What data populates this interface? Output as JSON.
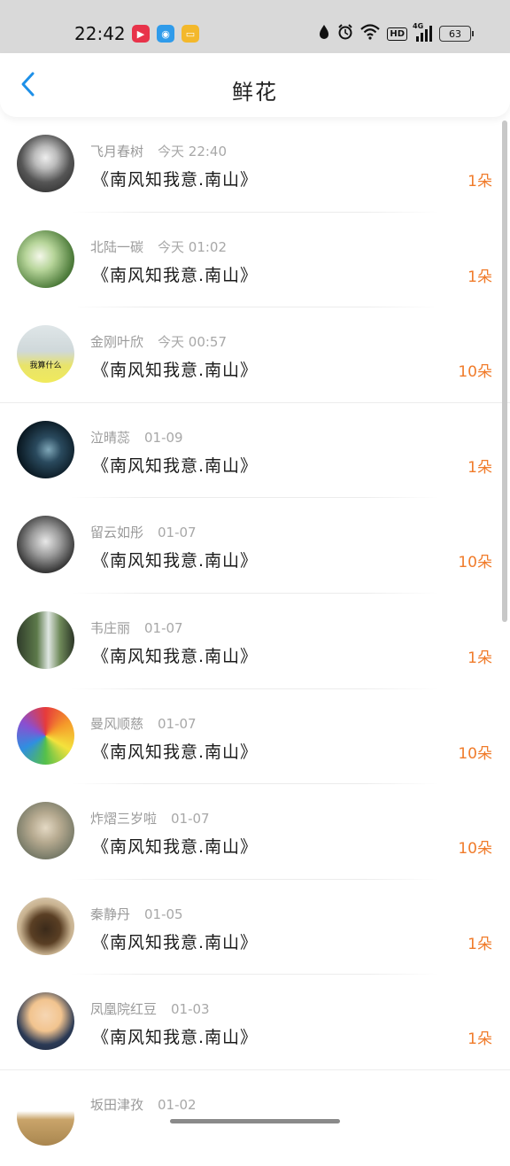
{
  "status_bar": {
    "time": "22:42",
    "battery": "63",
    "network_label": "HD",
    "signal_label": "4G"
  },
  "header": {
    "title": "鲜花",
    "back_icon": "chevron-left-icon"
  },
  "colors": {
    "accent": "#1e90e8",
    "count": "#f07b2a",
    "meta": "#9a9a9a"
  },
  "items": [
    {
      "name": "飞月春树",
      "time": "今天 22:40",
      "message": "《南风知我意.南山》",
      "count": "1朵"
    },
    {
      "name": "北陆一碳",
      "time": "今天 01:02",
      "message": "《南风知我意.南山》",
      "count": "1朵"
    },
    {
      "name": "金刚叶欣",
      "time": "今天 00:57",
      "message": "《南风知我意.南山》",
      "count": "10朵",
      "avatar_caption": "我算什么"
    },
    {
      "name": "泣晴蕊",
      "time": "01-09",
      "message": "《南风知我意.南山》",
      "count": "1朵"
    },
    {
      "name": "留云如彤",
      "time": "01-07",
      "message": "《南风知我意.南山》",
      "count": "10朵"
    },
    {
      "name": "韦庄丽",
      "time": "01-07",
      "message": "《南风知我意.南山》",
      "count": "1朵"
    },
    {
      "name": "曼风顺慈",
      "time": "01-07",
      "message": "《南风知我意.南山》",
      "count": "10朵"
    },
    {
      "name": "炸熠三岁啦",
      "time": "01-07",
      "message": "《南风知我意.南山》",
      "count": "10朵"
    },
    {
      "name": "秦静丹",
      "time": "01-05",
      "message": "《南风知我意.南山》",
      "count": "1朵"
    },
    {
      "name": "凤凰院红豆",
      "time": "01-03",
      "message": "《南风知我意.南山》",
      "count": "1朵"
    },
    {
      "name": "坂田津孜",
      "time": "01-02",
      "message": "",
      "count": ""
    }
  ]
}
